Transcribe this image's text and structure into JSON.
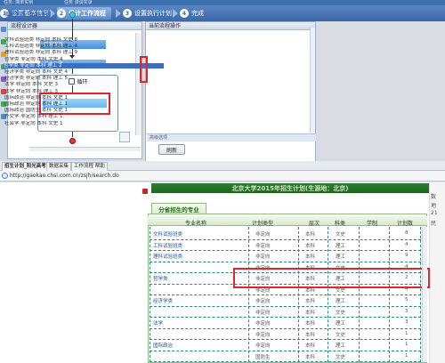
{
  "top_strip": {
    "left": "任务: 简单实例",
    "right": "任务 漫谈实录"
  },
  "wizard": {
    "steps": [
      {
        "num": "1",
        "label": "设置基本信息"
      },
      {
        "num": "2",
        "label": "设计工作流程"
      },
      {
        "num": "3",
        "label": "设置执行计划"
      },
      {
        "num": "4",
        "label": "完成"
      }
    ],
    "active_step": 2
  },
  "designer": {
    "title": "流程设计器",
    "nodes": {
      "open_page": "打开网页",
      "click_element": "点击元素",
      "loop": "循环",
      "extract": "提取数据"
    }
  },
  "operations": {
    "title": "当前流程操作",
    "list_header": "循环列表 [总共 46]",
    "items": [
      "文科试验班类 非定向 本科 文史 8",
      "工科试验班类 非定向 本科 理工 4",
      "理科试验班类 非定向 本科 理工 9",
      "哲学类 非定向 本科 文史 4",
      "哲学类 非定向 本科 理工 2",
      "经济学类 非定向 本科 文史 4",
      "经济学类 非定向 本科 理工 5",
      "法学 非定向 本科 文史 3",
      "法学 非定向 本科 理工 3",
      "国际政治 非定向 本科 文史 1",
      "国际政治 非定向 本科 理工 1",
      "国际政治 国防生 本科 文史 1",
      "外交学 非定向 本科 理工 1",
      "社会学 非定向 本科 文史 1"
    ],
    "selected_index": 4,
    "pager_text": "高级选项",
    "refresh_label": "刷新"
  },
  "browser": {
    "tabs": [
      "招生计划_阳光高考",
      "数据采集",
      "工作流程 帮助"
    ],
    "active_tab": 0,
    "url": "http://gaokao.chsi.com.cn/zsjh/search.do"
  },
  "page": {
    "banner": "北京大学2015年招生计划(生源地：北京)",
    "tab_title": "分省招生的专业",
    "columns": [
      "专业名称",
      "计划类型",
      "层次",
      "科类",
      "学制",
      "计划数"
    ],
    "rows": [
      {
        "major": "文科试验班类",
        "type": "非定向",
        "level": "本科",
        "subject": "文史",
        "duration": "",
        "count": "8"
      },
      {
        "major": "工科试验班类",
        "type": "非定向",
        "level": "本科",
        "subject": "理工",
        "duration": "",
        "count": "4"
      },
      {
        "major": "理科试验班类",
        "type": "非定向",
        "level": "本科",
        "subject": "理工",
        "duration": "",
        "count": "9"
      },
      {
        "major": "",
        "type": "非定向",
        "level": "本科",
        "subject": "文史",
        "duration": "",
        "count": "4"
      },
      {
        "major": "哲学类",
        "type": "非定向",
        "level": "本科",
        "subject": "理工",
        "duration": "",
        "count": "2"
      },
      {
        "major": "",
        "type": "非定向",
        "level": "本科",
        "subject": "文史",
        "duration": "",
        "count": "4"
      },
      {
        "major": "经济学类",
        "type": "非定向",
        "level": "本科",
        "subject": "理工",
        "duration": "",
        "count": "5"
      },
      {
        "major": "",
        "type": "非定向",
        "level": "本科",
        "subject": "文史",
        "duration": "",
        "count": "3"
      },
      {
        "major": "法学",
        "type": "非定向",
        "level": "本科",
        "subject": "理工",
        "duration": "",
        "count": "3"
      },
      {
        "major": "",
        "type": "非定向",
        "level": "本科",
        "subject": "文史",
        "duration": "",
        "count": "1"
      },
      {
        "major": "国际政治",
        "type": "非定向",
        "level": "本科",
        "subject": "理工",
        "duration": "",
        "count": "1"
      },
      {
        "major": "",
        "type": "国防生",
        "level": "本科",
        "subject": "文史",
        "duration": "",
        "count": "1"
      }
    ],
    "sidebar_texts": [
      "数",
      "地",
      "21",
      "民"
    ]
  },
  "colors": {
    "accent": "#3b67a7",
    "highlight_red": "#e0262a",
    "table_green": "#2e8a7a",
    "banner_green": "#1f6420"
  }
}
